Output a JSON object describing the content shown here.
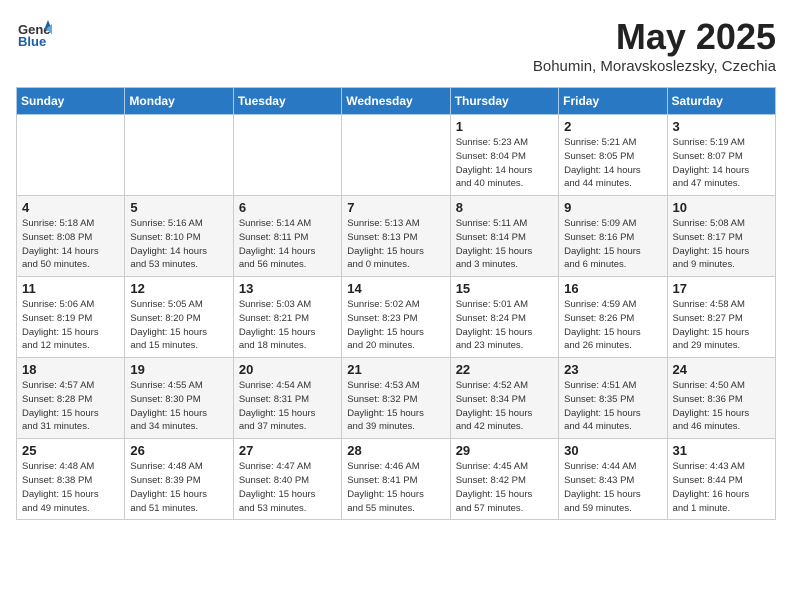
{
  "header": {
    "logo_general": "General",
    "logo_blue": "Blue",
    "title": "May 2025",
    "location": "Bohumin, Moravskoslezsky, Czechia"
  },
  "weekdays": [
    "Sunday",
    "Monday",
    "Tuesday",
    "Wednesday",
    "Thursday",
    "Friday",
    "Saturday"
  ],
  "weeks": [
    [
      {
        "day": "",
        "info": ""
      },
      {
        "day": "",
        "info": ""
      },
      {
        "day": "",
        "info": ""
      },
      {
        "day": "",
        "info": ""
      },
      {
        "day": "1",
        "info": "Sunrise: 5:23 AM\nSunset: 8:04 PM\nDaylight: 14 hours\nand 40 minutes."
      },
      {
        "day": "2",
        "info": "Sunrise: 5:21 AM\nSunset: 8:05 PM\nDaylight: 14 hours\nand 44 minutes."
      },
      {
        "day": "3",
        "info": "Sunrise: 5:19 AM\nSunset: 8:07 PM\nDaylight: 14 hours\nand 47 minutes."
      }
    ],
    [
      {
        "day": "4",
        "info": "Sunrise: 5:18 AM\nSunset: 8:08 PM\nDaylight: 14 hours\nand 50 minutes."
      },
      {
        "day": "5",
        "info": "Sunrise: 5:16 AM\nSunset: 8:10 PM\nDaylight: 14 hours\nand 53 minutes."
      },
      {
        "day": "6",
        "info": "Sunrise: 5:14 AM\nSunset: 8:11 PM\nDaylight: 14 hours\nand 56 minutes."
      },
      {
        "day": "7",
        "info": "Sunrise: 5:13 AM\nSunset: 8:13 PM\nDaylight: 15 hours\nand 0 minutes."
      },
      {
        "day": "8",
        "info": "Sunrise: 5:11 AM\nSunset: 8:14 PM\nDaylight: 15 hours\nand 3 minutes."
      },
      {
        "day": "9",
        "info": "Sunrise: 5:09 AM\nSunset: 8:16 PM\nDaylight: 15 hours\nand 6 minutes."
      },
      {
        "day": "10",
        "info": "Sunrise: 5:08 AM\nSunset: 8:17 PM\nDaylight: 15 hours\nand 9 minutes."
      }
    ],
    [
      {
        "day": "11",
        "info": "Sunrise: 5:06 AM\nSunset: 8:19 PM\nDaylight: 15 hours\nand 12 minutes."
      },
      {
        "day": "12",
        "info": "Sunrise: 5:05 AM\nSunset: 8:20 PM\nDaylight: 15 hours\nand 15 minutes."
      },
      {
        "day": "13",
        "info": "Sunrise: 5:03 AM\nSunset: 8:21 PM\nDaylight: 15 hours\nand 18 minutes."
      },
      {
        "day": "14",
        "info": "Sunrise: 5:02 AM\nSunset: 8:23 PM\nDaylight: 15 hours\nand 20 minutes."
      },
      {
        "day": "15",
        "info": "Sunrise: 5:01 AM\nSunset: 8:24 PM\nDaylight: 15 hours\nand 23 minutes."
      },
      {
        "day": "16",
        "info": "Sunrise: 4:59 AM\nSunset: 8:26 PM\nDaylight: 15 hours\nand 26 minutes."
      },
      {
        "day": "17",
        "info": "Sunrise: 4:58 AM\nSunset: 8:27 PM\nDaylight: 15 hours\nand 29 minutes."
      }
    ],
    [
      {
        "day": "18",
        "info": "Sunrise: 4:57 AM\nSunset: 8:28 PM\nDaylight: 15 hours\nand 31 minutes."
      },
      {
        "day": "19",
        "info": "Sunrise: 4:55 AM\nSunset: 8:30 PM\nDaylight: 15 hours\nand 34 minutes."
      },
      {
        "day": "20",
        "info": "Sunrise: 4:54 AM\nSunset: 8:31 PM\nDaylight: 15 hours\nand 37 minutes."
      },
      {
        "day": "21",
        "info": "Sunrise: 4:53 AM\nSunset: 8:32 PM\nDaylight: 15 hours\nand 39 minutes."
      },
      {
        "day": "22",
        "info": "Sunrise: 4:52 AM\nSunset: 8:34 PM\nDaylight: 15 hours\nand 42 minutes."
      },
      {
        "day": "23",
        "info": "Sunrise: 4:51 AM\nSunset: 8:35 PM\nDaylight: 15 hours\nand 44 minutes."
      },
      {
        "day": "24",
        "info": "Sunrise: 4:50 AM\nSunset: 8:36 PM\nDaylight: 15 hours\nand 46 minutes."
      }
    ],
    [
      {
        "day": "25",
        "info": "Sunrise: 4:48 AM\nSunset: 8:38 PM\nDaylight: 15 hours\nand 49 minutes."
      },
      {
        "day": "26",
        "info": "Sunrise: 4:48 AM\nSunset: 8:39 PM\nDaylight: 15 hours\nand 51 minutes."
      },
      {
        "day": "27",
        "info": "Sunrise: 4:47 AM\nSunset: 8:40 PM\nDaylight: 15 hours\nand 53 minutes."
      },
      {
        "day": "28",
        "info": "Sunrise: 4:46 AM\nSunset: 8:41 PM\nDaylight: 15 hours\nand 55 minutes."
      },
      {
        "day": "29",
        "info": "Sunrise: 4:45 AM\nSunset: 8:42 PM\nDaylight: 15 hours\nand 57 minutes."
      },
      {
        "day": "30",
        "info": "Sunrise: 4:44 AM\nSunset: 8:43 PM\nDaylight: 15 hours\nand 59 minutes."
      },
      {
        "day": "31",
        "info": "Sunrise: 4:43 AM\nSunset: 8:44 PM\nDaylight: 16 hours\nand 1 minute."
      }
    ]
  ]
}
